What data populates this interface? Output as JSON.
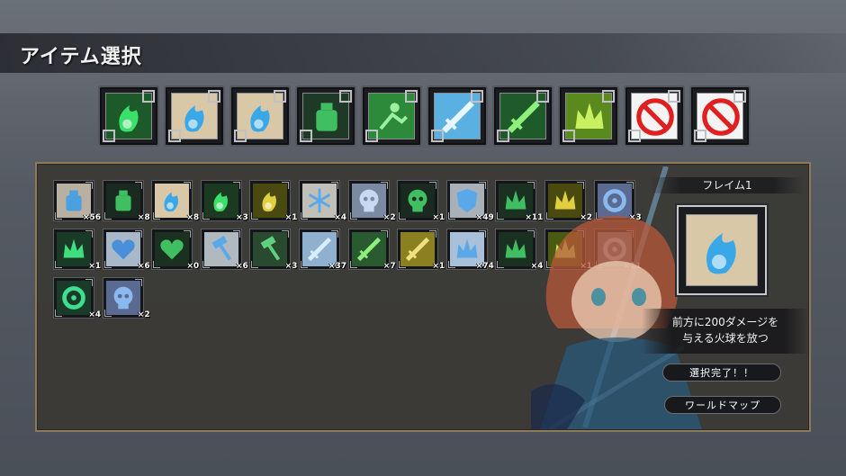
{
  "header": {
    "title": "アイテム選択"
  },
  "equipped": [
    {
      "icon": "green-flame-icon",
      "bg": "#1c5a2a",
      "fg": "#3be06a"
    },
    {
      "icon": "blue-flame-icon",
      "bg": "#d8c8a8",
      "fg": "#3aa8e8"
    },
    {
      "icon": "blue-flame-icon",
      "bg": "#d8c8a8",
      "fg": "#3aa8e8"
    },
    {
      "icon": "green-bottle-icon",
      "bg": "#1e3a26",
      "fg": "#3fbf62"
    },
    {
      "icon": "green-dash-icon",
      "bg": "#2c8a3a",
      "fg": "#9cf0a0"
    },
    {
      "icon": "blue-sword-icon",
      "bg": "#5ab0e0",
      "fg": "#e8f6ff"
    },
    {
      "icon": "green-sword-icon",
      "bg": "#1e5a2a",
      "fg": "#8ef07a"
    },
    {
      "icon": "green-crown-icon",
      "bg": "#5a8a1e",
      "fg": "#c8f060"
    },
    {
      "icon": "empty-slot-icon",
      "bg": "#ffffff",
      "fg": "#e02020"
    },
    {
      "icon": "empty-slot-icon",
      "bg": "#ffffff",
      "fg": "#e02020"
    }
  ],
  "inventory": [
    {
      "icon": "blue-bottle-icon",
      "bg": "#b8b0a0",
      "fg": "#4aa0e0",
      "count": "×56"
    },
    {
      "icon": "green-bottle-icon",
      "bg": "#1a2a20",
      "fg": "#3fbf62",
      "count": "×8"
    },
    {
      "icon": "blue-flame-icon",
      "bg": "#d8c8a8",
      "fg": "#3aa8e8",
      "count": "×8"
    },
    {
      "icon": "green-flame-icon",
      "bg": "#1c3a22",
      "fg": "#3be06a",
      "count": "×3"
    },
    {
      "icon": "yellow-flame-icon",
      "bg": "#4a4a10",
      "fg": "#e0d040",
      "count": "×1"
    },
    {
      "icon": "blue-snowflake-icon",
      "bg": "#c0c0b8",
      "fg": "#5aa8e8",
      "count": "×4"
    },
    {
      "icon": "blue-skull-icon",
      "bg": "#7a8aa0",
      "fg": "#c8d8f0",
      "count": "×2"
    },
    {
      "icon": "green-skull-icon",
      "bg": "#1a2a20",
      "fg": "#3fbf62",
      "count": "×1"
    },
    {
      "icon": "blue-shield-icon",
      "bg": "#a8b0b8",
      "fg": "#5aa8e8",
      "count": "×49"
    },
    {
      "icon": "green-spike-icon",
      "bg": "#1a3020",
      "fg": "#3fbf62",
      "count": "×11"
    },
    {
      "icon": "yellow-spike-icon",
      "bg": "#4a4a10",
      "fg": "#e0d040",
      "count": "×2"
    },
    {
      "icon": "blue-gear-icon",
      "bg": "#5a6a90",
      "fg": "#8ab8f0",
      "count": "×3"
    },
    {
      "icon": "green-spike-icon",
      "bg": "#1a3a28",
      "fg": "#3fdf80",
      "count": "×1"
    },
    {
      "icon": "blue-heart-icon",
      "bg": "#a8b8c8",
      "fg": "#4a90d8",
      "count": "×6"
    },
    {
      "icon": "green-heart-icon",
      "bg": "#1a3020",
      "fg": "#3fbf62",
      "count": "×0"
    },
    {
      "icon": "blue-hammer-icon",
      "bg": "#b0b8c0",
      "fg": "#5aa8e8",
      "count": "×6"
    },
    {
      "icon": "green-hammer-icon",
      "bg": "#2a4a30",
      "fg": "#60d080",
      "count": "×3"
    },
    {
      "icon": "blue-sword-icon",
      "bg": "#90b0d0",
      "fg": "#d8eeff",
      "count": "×37"
    },
    {
      "icon": "green-sword-icon",
      "bg": "#2a5a30",
      "fg": "#8ef07a",
      "count": "×7"
    },
    {
      "icon": "yellow-sword-icon",
      "bg": "#8a8020",
      "fg": "#f0e080",
      "count": "×1"
    },
    {
      "icon": "blue-crown-icon",
      "bg": "#a8c0d8",
      "fg": "#5aa8e8",
      "count": "×74"
    },
    {
      "icon": "green-crown-icon",
      "bg": "#1a3020",
      "fg": "#3fbf62",
      "count": "×4"
    },
    {
      "icon": "yellow-crown-icon",
      "bg": "#4a5a10",
      "fg": "#c8f060",
      "count": "×1"
    },
    {
      "icon": "blue-ring-icon",
      "bg": "#6a7a90",
      "fg": "#a8d0f0",
      "count": "×11"
    },
    {
      "icon": "green-ring-icon",
      "bg": "#1a3a2a",
      "fg": "#3fdf90",
      "count": "×4"
    },
    {
      "icon": "blue-ghost-icon",
      "bg": "#5a6a90",
      "fg": "#8ab8f0",
      "count": "×2"
    }
  ],
  "detail": {
    "name": "フレイム1",
    "icon": "blue-flame-icon",
    "bg": "#d8c8a8",
    "fg": "#3aa8e8",
    "description_line1": "前方に200ダメージを",
    "description_line2": "与える火球を放つ"
  },
  "buttons": {
    "confirm": "選択完了！！",
    "world_map": "ワールドマップ"
  },
  "colors": {
    "panel_border": "#8c7a5a",
    "forbidden_red": "#e02020"
  }
}
